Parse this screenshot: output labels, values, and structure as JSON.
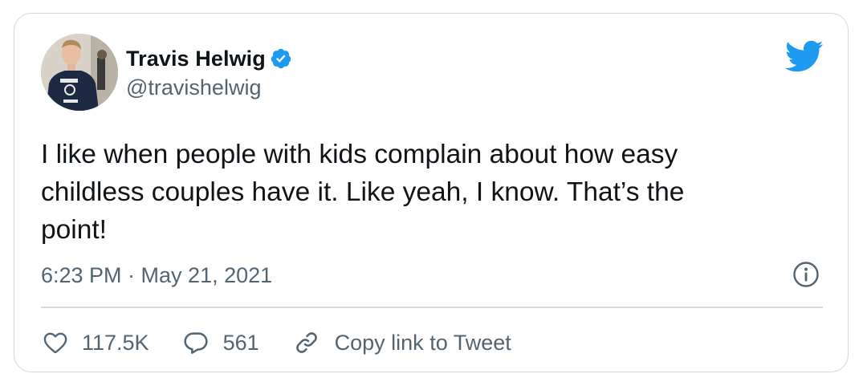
{
  "author": {
    "name": "Travis Helwig",
    "handle": "@travishelwig",
    "verified": true
  },
  "tweet": {
    "text_lines": [
      "I like when people with kids complain about how easy",
      "childless couples have it. Like yeah, I know. That’s the",
      "point!"
    ],
    "timestamp": "6:23 PM · May 21, 2021"
  },
  "actions": {
    "likes": "117.5K",
    "replies": "561",
    "copy_link_label": "Copy link to Tweet"
  },
  "icons": {
    "brand": "twitter-bird-icon",
    "verified": "verified-badge-icon",
    "info": "info-icon",
    "like": "heart-icon",
    "reply": "reply-bubble-icon",
    "link": "link-icon"
  },
  "colors": {
    "brand_blue": "#1d9bf0",
    "text_primary": "#0f1419",
    "text_secondary": "#536471",
    "border": "#cfd9de"
  }
}
